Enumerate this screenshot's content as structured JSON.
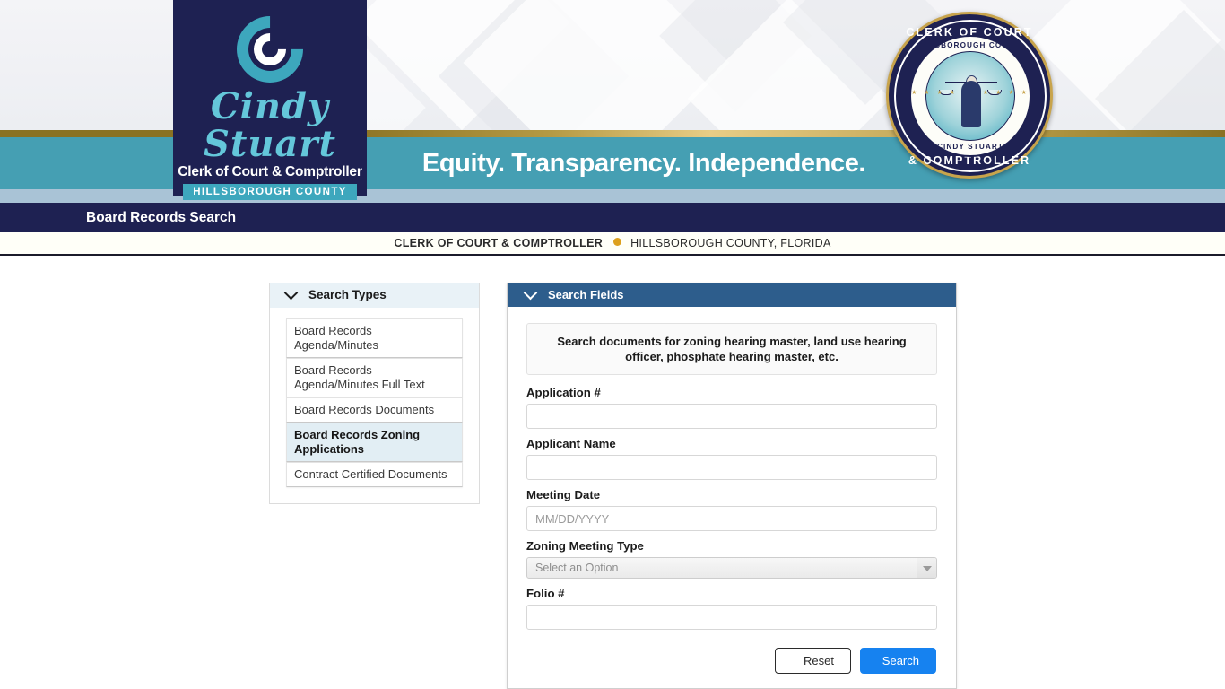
{
  "header": {
    "logo": {
      "script_name": "Cindy Stuart",
      "subtitle": "Clerk of Court & Comptroller",
      "county": "HILLSBOROUGH COUNTY",
      "monogram": "C-monogram"
    },
    "seal": {
      "top_text": "CLERK OF COURT",
      "bottom_text": "& COMPTROLLER",
      "inner_top_text": "HILLSBOROUGH COUNTY",
      "inner_bottom_text": "CINDY STUART",
      "stars": "★ ★ ★ ★ ★"
    },
    "tagline": "Equity. Transparency. Independence.",
    "app_title": "Board Records Search",
    "subheader": {
      "office": "CLERK OF COURT & COMPTROLLER",
      "location": "HILLSBOROUGH COUNTY, FLORIDA",
      "separator_dot_color": "#dda01e"
    }
  },
  "search_types": {
    "title": "Search Types",
    "collapse_icon": "chevron-down-icon",
    "items": [
      {
        "label": "Board Records Agenda/Minutes",
        "selected": false
      },
      {
        "label": "Board Records Agenda/Minutes Full Text",
        "selected": false
      },
      {
        "label": "Board Records Documents",
        "selected": false
      },
      {
        "label": "Board Records Zoning Applications",
        "selected": true
      },
      {
        "label": "Contract Certified Documents",
        "selected": false
      }
    ]
  },
  "search_fields": {
    "title": "Search Fields",
    "collapse_icon": "chevron-down-icon",
    "info_text": "Search documents for zoning hearing master, land use hearing officer, phosphate hearing master, etc.",
    "fields": [
      {
        "label": "Application #",
        "value": "",
        "placeholder": ""
      },
      {
        "label": "Applicant Name",
        "value": "",
        "placeholder": ""
      },
      {
        "label": "Meeting Date",
        "value": "",
        "placeholder": "MM/DD/YYYY"
      },
      {
        "label": "Zoning Meeting Type",
        "value": "",
        "placeholder": "Select an Option"
      },
      {
        "label": "Folio #",
        "value": "",
        "placeholder": ""
      }
    ],
    "buttons": {
      "reset": "Reset",
      "search": "Search"
    }
  },
  "colors": {
    "navy": "#1e2152",
    "teal": "#459fb3",
    "gold": "#b59a44",
    "panel_header_blue": "#2d5d8c",
    "search_button_blue": "#1682f0",
    "selected_item_bg": "#e2eef4"
  }
}
